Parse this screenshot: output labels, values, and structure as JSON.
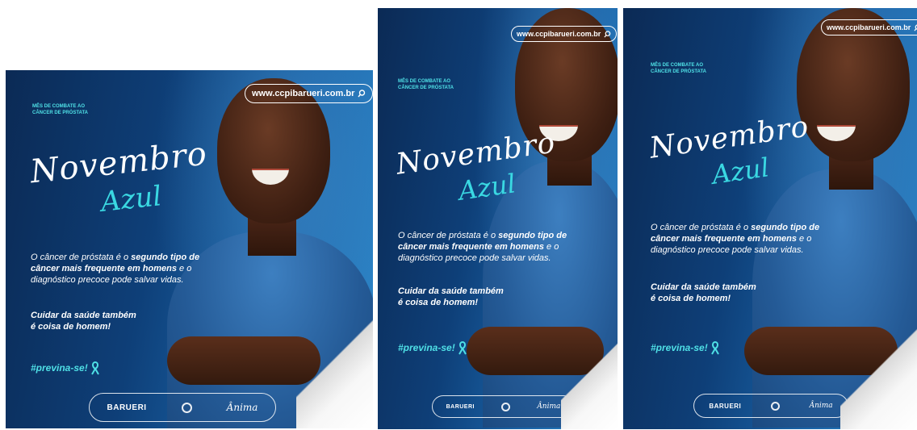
{
  "posters": [
    {
      "url": "www.ccpibarueri.com.br",
      "kicker_line1": "MÊS DE COMBATE AO",
      "kicker_line2": "CÂNCER DE PRÓSTATA",
      "title_line1": "Novembro",
      "title_line2": "Azul",
      "body_part1": "O câncer de próstata é o ",
      "body_bold1": "segundo tipo de câncer mais frequente em homens",
      "body_part2": " e o diagnóstico precoce pode salvar vidas.",
      "cta_line1": "Cuidar da saúde também",
      "cta_line2": "é coisa de homem!",
      "hashtag": "#previna-se!",
      "logo1": "BARUERI",
      "logo3": "Ânima"
    },
    {
      "url": "www.ccpibarueri.com.br",
      "kicker_line1": "MÊS DE COMBATE AO",
      "kicker_line2": "CÂNCER DE PRÓSTATA",
      "title_line1": "Novembro",
      "title_line2": "Azul",
      "body_part1": "O câncer de próstata é o ",
      "body_bold1": "segundo tipo de câncer mais frequente em homens",
      "body_part2": " e o diagnóstico precoce pode salvar vidas.",
      "cta_line1": "Cuidar da saúde também",
      "cta_line2": "é coisa de homem!",
      "hashtag": "#previna-se!",
      "logo1": "BARUERI",
      "logo3": "Ânima"
    },
    {
      "url": "www.ccpibarueri.com.br",
      "kicker_line1": "MÊS DE COMBATE AO",
      "kicker_line2": "CÂNCER DE PRÓSTATA",
      "title_line1": "Novembro",
      "title_line2": "Azul",
      "body_part1": "O câncer de próstata é o ",
      "body_bold1": "segundo tipo de câncer mais frequente em homens",
      "body_part2": " e o diagnóstico precoce pode salvar vidas.",
      "cta_line1": "Cuidar da saúde também",
      "cta_line2": "é coisa de homem!",
      "hashtag": "#previna-se!",
      "logo1": "BARUERI",
      "logo3": "Ânima"
    }
  ],
  "colors": {
    "accent_cyan": "#4fe0e6",
    "navy": "#0b2a55",
    "shirt_blue": "#245a96"
  },
  "icons": [
    "search-icon",
    "awareness-ribbon-icon",
    "ccpi-logo-icon"
  ]
}
